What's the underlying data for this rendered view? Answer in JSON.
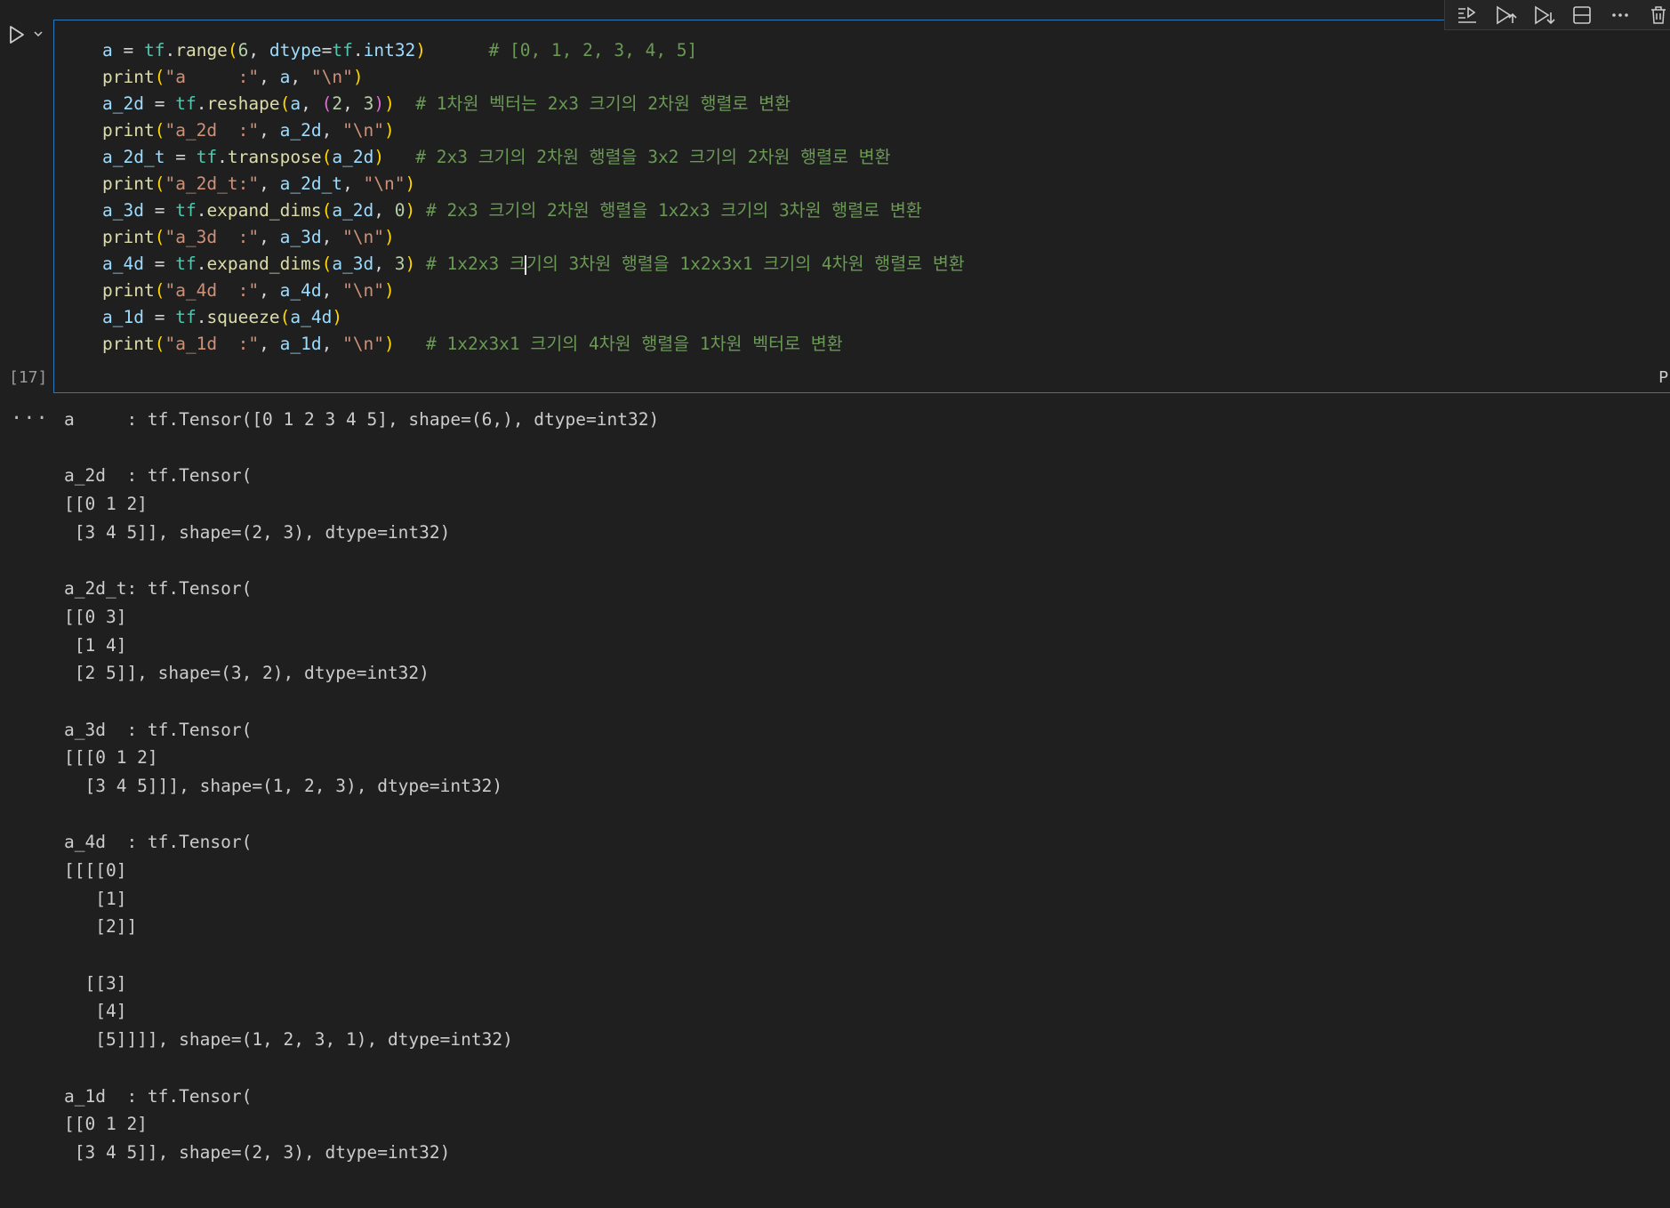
{
  "cell": {
    "execution_count": "[17]",
    "right_label": "P",
    "code_lines": [
      [
        [
          "a",
          "v"
        ],
        [
          " = ",
          "o"
        ],
        [
          "tf",
          "m"
        ],
        [
          ".",
          "o"
        ],
        [
          "range",
          "f"
        ],
        [
          "(",
          "p"
        ],
        [
          "6",
          "n"
        ],
        [
          ", ",
          "o"
        ],
        [
          "dtype",
          "v"
        ],
        [
          "=",
          "o"
        ],
        [
          "tf",
          "m"
        ],
        [
          ".",
          "o"
        ],
        [
          "int32",
          "v"
        ],
        [
          ")",
          "p"
        ],
        [
          "      # [0, 1, 2, 3, 4, 5]",
          "c"
        ]
      ],
      [
        [
          "print",
          "f"
        ],
        [
          "(",
          "p"
        ],
        [
          "\"a     :\"",
          "s"
        ],
        [
          ", ",
          "o"
        ],
        [
          "a",
          "v"
        ],
        [
          ", ",
          "o"
        ],
        [
          "\"\\n\"",
          "s"
        ],
        [
          ")",
          "p"
        ]
      ],
      [
        [
          "a_2d",
          "v"
        ],
        [
          " = ",
          "o"
        ],
        [
          "tf",
          "m"
        ],
        [
          ".",
          "o"
        ],
        [
          "reshape",
          "f"
        ],
        [
          "(",
          "p"
        ],
        [
          "a",
          "v"
        ],
        [
          ", ",
          "o"
        ],
        [
          "(",
          "pp"
        ],
        [
          "2",
          "n"
        ],
        [
          ", ",
          "o"
        ],
        [
          "3",
          "n"
        ],
        [
          ")",
          "pp"
        ],
        [
          ")",
          "p"
        ],
        [
          "  # 1차원 벡터는 2x3 크기의 2차원 행렬로 변환",
          "c"
        ]
      ],
      [
        [
          "print",
          "f"
        ],
        [
          "(",
          "p"
        ],
        [
          "\"a_2d  :\"",
          "s"
        ],
        [
          ", ",
          "o"
        ],
        [
          "a_2d",
          "v"
        ],
        [
          ", ",
          "o"
        ],
        [
          "\"\\n\"",
          "s"
        ],
        [
          ")",
          "p"
        ]
      ],
      [
        [
          "a_2d_t",
          "v"
        ],
        [
          " = ",
          "o"
        ],
        [
          "tf",
          "m"
        ],
        [
          ".",
          "o"
        ],
        [
          "transpose",
          "f"
        ],
        [
          "(",
          "p"
        ],
        [
          "a_2d",
          "v"
        ],
        [
          ")",
          "p"
        ],
        [
          "   # 2x3 크기의 2차원 행렬을 3x2 크기의 2차원 행렬로 변환",
          "c"
        ]
      ],
      [
        [
          "print",
          "f"
        ],
        [
          "(",
          "p"
        ],
        [
          "\"a_2d_t:\"",
          "s"
        ],
        [
          ", ",
          "o"
        ],
        [
          "a_2d_t",
          "v"
        ],
        [
          ", ",
          "o"
        ],
        [
          "\"\\n\"",
          "s"
        ],
        [
          ")",
          "p"
        ]
      ],
      [
        [
          "a_3d",
          "v"
        ],
        [
          " = ",
          "o"
        ],
        [
          "tf",
          "m"
        ],
        [
          ".",
          "o"
        ],
        [
          "expand_dims",
          "f"
        ],
        [
          "(",
          "p"
        ],
        [
          "a_2d",
          "v"
        ],
        [
          ", ",
          "o"
        ],
        [
          "0",
          "n"
        ],
        [
          ")",
          "p"
        ],
        [
          " # 2x3 크기의 2차원 행렬을 1x2x3 크기의 3차원 행렬로 변환",
          "c"
        ]
      ],
      [
        [
          "print",
          "f"
        ],
        [
          "(",
          "p"
        ],
        [
          "\"a_3d  :\"",
          "s"
        ],
        [
          ", ",
          "o"
        ],
        [
          "a_3d",
          "v"
        ],
        [
          ", ",
          "o"
        ],
        [
          "\"\\n\"",
          "s"
        ],
        [
          ")",
          "p"
        ]
      ],
      [
        [
          "a_4d",
          "v"
        ],
        [
          " = ",
          "o"
        ],
        [
          "tf",
          "m"
        ],
        [
          ".",
          "o"
        ],
        [
          "expand_dims",
          "f"
        ],
        [
          "(",
          "p"
        ],
        [
          "a_3d",
          "v"
        ],
        [
          ", ",
          "o"
        ],
        [
          "3",
          "n"
        ],
        [
          ")",
          "p"
        ],
        [
          " # 1x2x3 크",
          "c"
        ],
        [
          "|CARET|",
          ""
        ],
        [
          "기의 3차원 행렬을 1x2x3x1 크기의 4차원 행렬로 변환",
          "c"
        ]
      ],
      [
        [
          "print",
          "f"
        ],
        [
          "(",
          "p"
        ],
        [
          "\"a_4d  :\"",
          "s"
        ],
        [
          ", ",
          "o"
        ],
        [
          "a_4d",
          "v"
        ],
        [
          ", ",
          "o"
        ],
        [
          "\"\\n\"",
          "s"
        ],
        [
          ")",
          "p"
        ]
      ],
      [
        [
          "a_1d",
          "v"
        ],
        [
          " = ",
          "o"
        ],
        [
          "tf",
          "m"
        ],
        [
          ".",
          "o"
        ],
        [
          "squeeze",
          "f"
        ],
        [
          "(",
          "p"
        ],
        [
          "a_4d",
          "v"
        ],
        [
          ")",
          "p"
        ]
      ],
      [
        [
          "print",
          "f"
        ],
        [
          "(",
          "p"
        ],
        [
          "\"a_1d  :\"",
          "s"
        ],
        [
          ", ",
          "o"
        ],
        [
          "a_1d",
          "v"
        ],
        [
          ", ",
          "o"
        ],
        [
          "\"\\n\"",
          "s"
        ],
        [
          ")",
          "p"
        ],
        [
          "   # 1x2x3x1 크기의 4차원 행렬을 1차원 벡터로 변환",
          "c"
        ]
      ]
    ]
  },
  "output": {
    "more_label": "···",
    "lines": [
      "a     : tf.Tensor([0 1 2 3 4 5], shape=(6,), dtype=int32)",
      "",
      "a_2d  : tf.Tensor(",
      "[[0 1 2]",
      " [3 4 5]], shape=(2, 3), dtype=int32)",
      "",
      "a_2d_t: tf.Tensor(",
      "[[0 3]",
      " [1 4]",
      " [2 5]], shape=(3, 2), dtype=int32)",
      "",
      "a_3d  : tf.Tensor(",
      "[[[0 1 2]",
      "  [3 4 5]]], shape=(1, 2, 3), dtype=int32)",
      "",
      "a_4d  : tf.Tensor(",
      "[[[[0]",
      "   [1]",
      "   [2]]",
      "",
      "  [[3]",
      "   [4]",
      "   [5]]]], shape=(1, 2, 3, 1), dtype=int32)",
      "",
      "a_1d  : tf.Tensor(",
      "[[0 1 2]",
      " [3 4 5]], shape=(2, 3), dtype=int32)"
    ]
  },
  "toolbar": {
    "icons": [
      "execute-above-icon",
      "run-above-icon",
      "run-below-icon",
      "split-cell-icon",
      "more-icon",
      "delete-icon"
    ]
  },
  "colors": {
    "accent_border": "#2b79b8",
    "background": "#1f1f1f",
    "comment": "#6a9955",
    "string": "#ce9178",
    "function": "#dcdcaa",
    "variable": "#9cdcfe",
    "module": "#4ec9b0",
    "number": "#b5cea8"
  }
}
